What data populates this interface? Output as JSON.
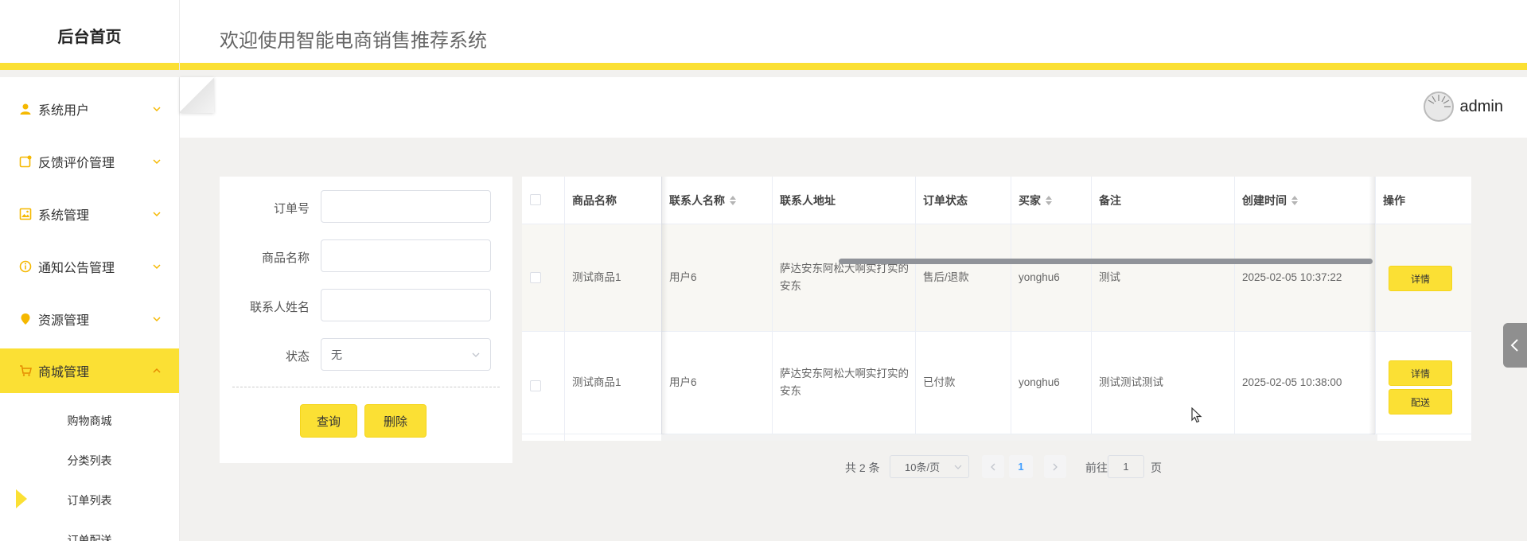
{
  "header": {
    "brand": "后台首页",
    "welcome": "欢迎使用智能电商销售推荐系统",
    "username": "admin",
    "accent_color": "#fbe034"
  },
  "sidebar": {
    "items": [
      {
        "label": "系统用户",
        "icon": "user-icon"
      },
      {
        "label": "反馈评价管理",
        "icon": "feedback-icon"
      },
      {
        "label": "系统管理",
        "icon": "image-icon"
      },
      {
        "label": "通知公告管理",
        "icon": "info-icon"
      },
      {
        "label": "资源管理",
        "icon": "pin-icon"
      },
      {
        "label": "商城管理",
        "icon": "cart-icon",
        "active": true
      }
    ],
    "subitems": [
      "购物商城",
      "分类列表",
      "订单列表",
      "订单配送"
    ],
    "active_subitem": "订单列表"
  },
  "search": {
    "order_no_label": "订单号",
    "order_no_value": "",
    "product_label": "商品名称",
    "product_value": "",
    "contact_label": "联系人姓名",
    "contact_value": "",
    "status_label": "状态",
    "status_value": "无",
    "query_button": "查询",
    "delete_button": "删除"
  },
  "table": {
    "columns": [
      "商品名称",
      "联系人名称",
      "联系人地址",
      "订单状态",
      "买家",
      "备注",
      "创建时间",
      "操作"
    ],
    "rows": [
      {
        "product": "测试商品1",
        "contact": "用户6",
        "address": "萨达安东阿松大啊实打实的安东",
        "status": "售后/退款",
        "buyer": "yonghu6",
        "note": "测试",
        "created": "2025-02-05 10:37:22",
        "actions": [
          "详情"
        ]
      },
      {
        "product": "测试商品1",
        "contact": "用户6",
        "address": "萨达安东阿松大啊实打实的安东",
        "status": "已付款",
        "buyer": "yonghu6",
        "note": "测试测试测试",
        "created": "2025-02-05 10:38:00",
        "actions": [
          "详情",
          "配送"
        ]
      }
    ]
  },
  "pagination": {
    "total": "共 2 条",
    "page_size": "10条/页",
    "current_page": "1",
    "goto_label": "前往",
    "goto_value": "1",
    "page_suffix": "页"
  }
}
